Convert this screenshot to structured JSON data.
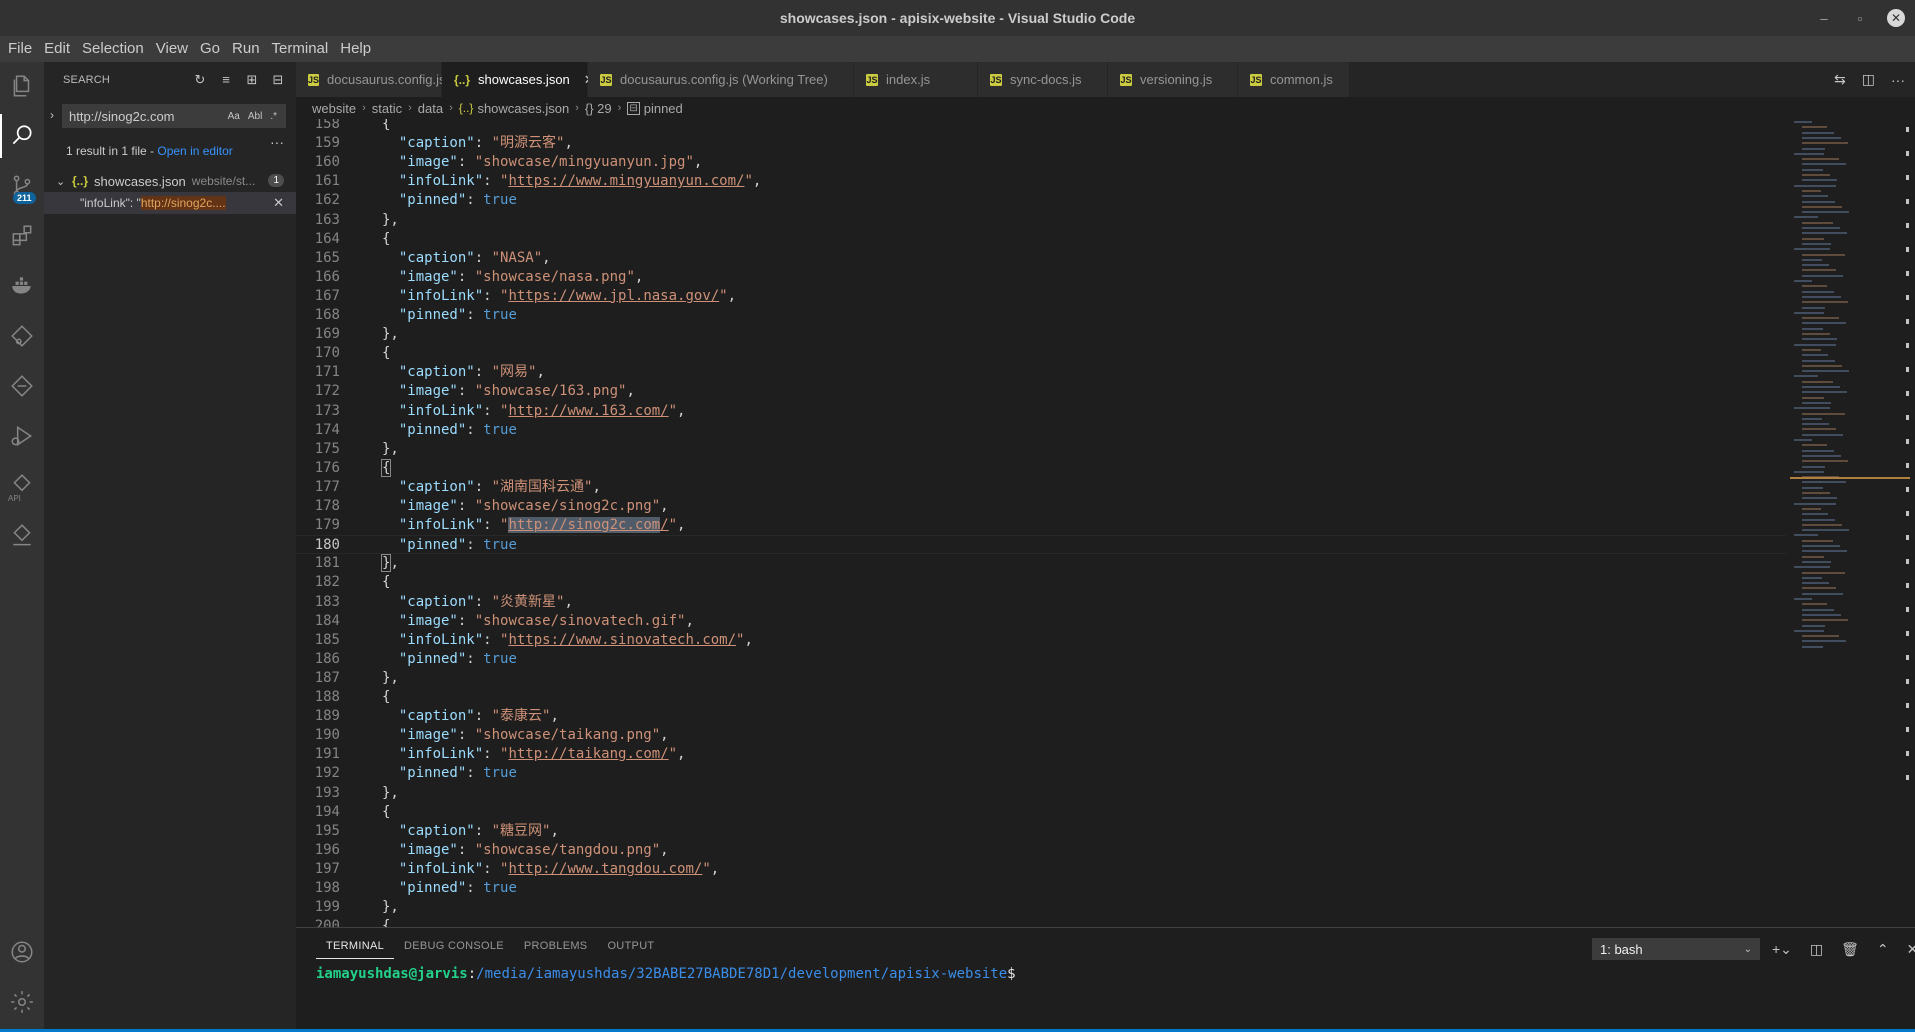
{
  "window": {
    "title": "showcases.json - apisix-website - Visual Studio Code"
  },
  "menu": [
    "File",
    "Edit",
    "Selection",
    "View",
    "Go",
    "Run",
    "Terminal",
    "Help"
  ],
  "activity_bar": {
    "scm_badge": "211",
    "api_label": "API"
  },
  "sidebar": {
    "header": "SEARCH",
    "search_value": "http://sinog2c.com",
    "opt_case": "Aa",
    "opt_word": "Abl",
    "opt_regex": ".*",
    "summary_text": "1 result in 1 file - ",
    "summary_link": "Open in editor",
    "file_name": "showcases.json",
    "file_path": "website/st...",
    "file_count": "1",
    "match_prefix": "\"infoLink\": \"",
    "match_hit": "http://sinog2c....",
    "match_remove": "✕"
  },
  "tabs": [
    {
      "label": "docusaurus.config.js",
      "icon": "JS"
    },
    {
      "label": "showcases.json",
      "icon": "{..}"
    },
    {
      "label": "docusaurus.config.js (Working Tree)",
      "icon": "JS"
    },
    {
      "label": "index.js",
      "icon": "JS"
    },
    {
      "label": "sync-docs.js",
      "icon": "JS"
    },
    {
      "label": "versioning.js",
      "icon": "JS"
    },
    {
      "label": "common.js",
      "icon": "JS"
    }
  ],
  "breadcrumb": {
    "parts": [
      "website",
      "static",
      "data",
      "showcases.json",
      "{} 29",
      "pinned"
    ]
  },
  "editor": {
    "current_line": 180,
    "lines": [
      {
        "n": "158",
        "kind": "open"
      },
      {
        "n": "159",
        "kind": "caption",
        "value": "明源云客"
      },
      {
        "n": "160",
        "kind": "image",
        "value": "showcase/mingyuanyun.jpg"
      },
      {
        "n": "161",
        "kind": "link",
        "value": "https://www.mingyuanyun.com/"
      },
      {
        "n": "162",
        "kind": "pinned",
        "value": "true"
      },
      {
        "n": "163",
        "kind": "close"
      },
      {
        "n": "164",
        "kind": "open"
      },
      {
        "n": "165",
        "kind": "caption",
        "value": "NASA"
      },
      {
        "n": "166",
        "kind": "image",
        "value": "showcase/nasa.png"
      },
      {
        "n": "167",
        "kind": "link",
        "value": "https://www.jpl.nasa.gov/"
      },
      {
        "n": "168",
        "kind": "pinned",
        "value": "true"
      },
      {
        "n": "169",
        "kind": "close"
      },
      {
        "n": "170",
        "kind": "open"
      },
      {
        "n": "171",
        "kind": "caption",
        "value": "网易"
      },
      {
        "n": "172",
        "kind": "image",
        "value": "showcase/163.png"
      },
      {
        "n": "173",
        "kind": "link",
        "value": "http://www.163.com/"
      },
      {
        "n": "174",
        "kind": "pinned",
        "value": "true"
      },
      {
        "n": "175",
        "kind": "close"
      },
      {
        "n": "176",
        "kind": "open-bracket"
      },
      {
        "n": "177",
        "kind": "caption",
        "value": "湖南国科云通"
      },
      {
        "n": "178",
        "kind": "image",
        "value": "showcase/sinog2c.png"
      },
      {
        "n": "179",
        "kind": "link-hl",
        "value": "http://sinog2c.com",
        "tail": "/"
      },
      {
        "n": "180",
        "kind": "pinned",
        "value": "true"
      },
      {
        "n": "181",
        "kind": "close-bracket"
      },
      {
        "n": "182",
        "kind": "open"
      },
      {
        "n": "183",
        "kind": "caption",
        "value": "炎黄新星"
      },
      {
        "n": "184",
        "kind": "image",
        "value": "showcase/sinovatech.gif"
      },
      {
        "n": "185",
        "kind": "link",
        "value": "https://www.sinovatech.com/"
      },
      {
        "n": "186",
        "kind": "pinned",
        "value": "true"
      },
      {
        "n": "187",
        "kind": "close"
      },
      {
        "n": "188",
        "kind": "open"
      },
      {
        "n": "189",
        "kind": "caption",
        "value": "泰康云"
      },
      {
        "n": "190",
        "kind": "image",
        "value": "showcase/taikang.png"
      },
      {
        "n": "191",
        "kind": "link",
        "value": "http://taikang.com/"
      },
      {
        "n": "192",
        "kind": "pinned",
        "value": "true"
      },
      {
        "n": "193",
        "kind": "close"
      },
      {
        "n": "194",
        "kind": "open"
      },
      {
        "n": "195",
        "kind": "caption",
        "value": "糖豆网"
      },
      {
        "n": "196",
        "kind": "image",
        "value": "showcase/tangdou.png"
      },
      {
        "n": "197",
        "kind": "link",
        "value": "http://www.tangdou.com/"
      },
      {
        "n": "198",
        "kind": "pinned",
        "value": "true"
      },
      {
        "n": "199",
        "kind": "close"
      },
      {
        "n": "200",
        "kind": "open"
      }
    ]
  },
  "panel": {
    "tabs": [
      "TERMINAL",
      "DEBUG CONSOLE",
      "PROBLEMS",
      "OUTPUT"
    ],
    "shell_select": "1: bash",
    "term_user": "iamayushdas@jarvis",
    "term_sep": ":",
    "term_path": "/media/iamayushdas/32BABE27BABDE78D1/development/apisix-website",
    "term_prompt": "$"
  },
  "colors": {
    "accent": "#007acc",
    "string": "#ce9178",
    "key": "#9cdcfe",
    "boolean": "#569cd6"
  }
}
